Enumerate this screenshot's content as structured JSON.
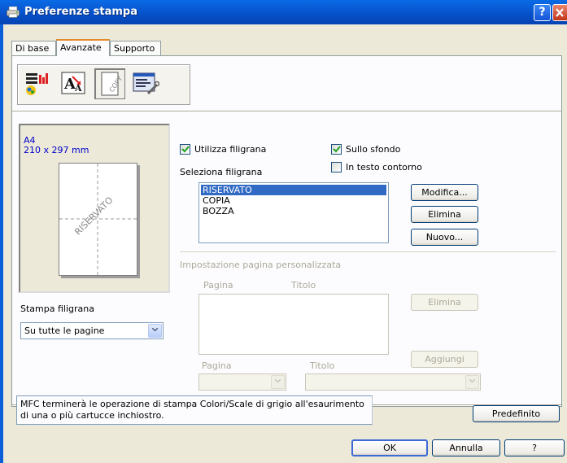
{
  "window": {
    "title": "Preferenze stampa",
    "help_button": "?",
    "close_button": "X"
  },
  "tabs": [
    {
      "label": "Di base",
      "active": false
    },
    {
      "label": "Avanzate",
      "active": true
    },
    {
      "label": "Supporto",
      "active": false
    }
  ],
  "toolbar_icons": [
    {
      "name": "color-icon",
      "selected": false
    },
    {
      "name": "scaling-icon",
      "selected": false
    },
    {
      "name": "watermark-copy-icon",
      "selected": true
    },
    {
      "name": "device-options-icon",
      "selected": false
    }
  ],
  "preview": {
    "paper_size": "A4",
    "paper_dims": "210 x 297 mm",
    "watermark_text": "RISERVATO"
  },
  "watermark_print": {
    "label": "Stampa filigrana",
    "value": "Su tutte le pagine"
  },
  "watermark": {
    "use_label": "Utilizza filigrana",
    "use_checked": true,
    "background_label": "Sullo sfondo",
    "background_checked": true,
    "outline_label": "In testo contorno",
    "outline_checked": false,
    "select_label": "Seleziona filigrana",
    "items": [
      "RISERVATO",
      "COPIA",
      "BOZZA"
    ],
    "selected_index": 0,
    "buttons": {
      "edit": "Modifica...",
      "delete": "Elimina",
      "new": "Nuovo..."
    }
  },
  "custom_page": {
    "group_label": "Impostazione pagina personalizzata",
    "col_page": "Pagina",
    "col_title": "Titolo",
    "delete_button": "Elimina",
    "add_button": "Aggiungi",
    "page_label": "Pagina",
    "title_label": "Titolo",
    "page_value": "",
    "title_value": ""
  },
  "status_message": "MFC terminerà le operazione di stampa Colori/Scale di grigio all'esaurimento di una o più cartucce inchiostro.",
  "buttons": {
    "default": "Predefinito",
    "ok": "OK",
    "cancel": "Annulla",
    "help": "?"
  }
}
